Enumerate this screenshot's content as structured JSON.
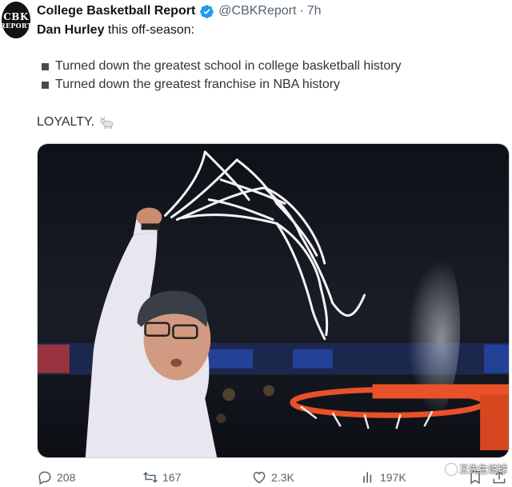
{
  "author": {
    "avatar_line1": "CBK",
    "avatar_line2": "REPORT",
    "display_name": "College Basketball Report",
    "handle": "@CBKReport",
    "separator": "·",
    "time": "7h",
    "verified_color": "#1d9bf0"
  },
  "tweet": {
    "intro_bold": "Dan Hurley",
    "intro_rest": " this off-season:",
    "bullets": [
      "Turned down the greatest school in college basketball history",
      "Turned down the greatest franchise in NBA history"
    ],
    "closing": "LOYALTY.",
    "closing_emoji": "goat-icon"
  },
  "actions": {
    "replies": "208",
    "reposts": "167",
    "likes": "2.3K",
    "views": "197K"
  },
  "watermark": {
    "text": "王先生说球"
  },
  "colors": {
    "text_primary": "#0f1419",
    "text_secondary": "#536471",
    "rim_orange": "#e8512a"
  }
}
